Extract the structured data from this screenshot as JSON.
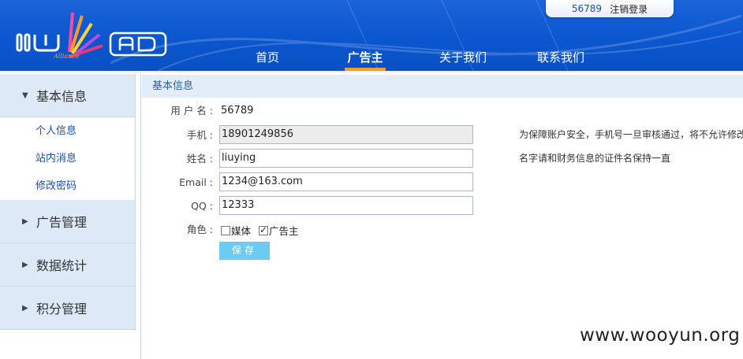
{
  "header": {
    "logo_subtext": "Alliance",
    "user_id": "56789",
    "logout_label": "注销登录",
    "nav": [
      {
        "label": "首页",
        "active": false
      },
      {
        "label": "广告主",
        "active": true
      },
      {
        "label": "关于我们",
        "active": false
      },
      {
        "label": "联系我们",
        "active": false
      }
    ]
  },
  "sidebar": {
    "groups": [
      {
        "label": "基本信息",
        "expanded": true,
        "items": [
          "个人信息",
          "站内消息",
          "修改密码"
        ]
      },
      {
        "label": "广告管理",
        "expanded": false
      },
      {
        "label": "数据统计",
        "expanded": false
      },
      {
        "label": "积分管理",
        "expanded": false
      }
    ]
  },
  "content": {
    "title": "基本信息",
    "username_label": "用 户 名 :",
    "username_value": "56789",
    "phone_label": "手机 :",
    "phone_value": "18901249856",
    "phone_hint": "为保障账户安全，手机号一旦审核通过，将不允许修改",
    "name_label": "姓名 :",
    "name_value": "liuying",
    "name_hint": "名字请和财务信息的证件名保持一直",
    "email_label": "Email :",
    "email_value": "1234@163.com",
    "qq_label": "QQ :",
    "qq_value": "12333",
    "role_label": "角色 :",
    "roles": [
      {
        "label": "媒体",
        "checked": false
      },
      {
        "label": "广告主",
        "checked": true
      }
    ],
    "save_label": "保存"
  },
  "watermark": "www.wooyun.org",
  "colors": {
    "header_blue": "#0b57cf",
    "nav_active_underline": "#f0a020",
    "sidebar_bg": "#dde9f7",
    "save_button": "#6ccbf3",
    "link_blue": "#1b4fa8"
  }
}
